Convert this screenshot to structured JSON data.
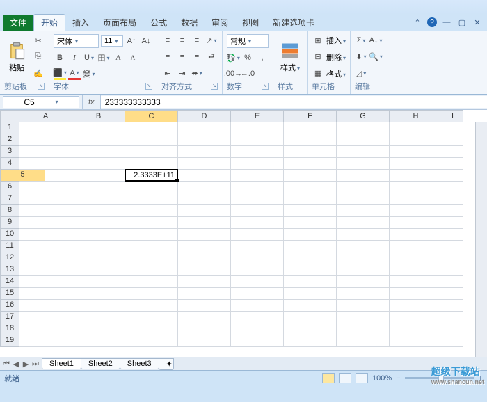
{
  "tabs": {
    "file": "文件",
    "home": "开始",
    "insert": "插入",
    "layout": "页面布局",
    "formulas": "公式",
    "data": "数据",
    "review": "审阅",
    "view": "视图",
    "newtab": "新建选项卡"
  },
  "ribbon": {
    "clipboard": {
      "label": "剪贴板",
      "paste": "粘贴"
    },
    "font": {
      "label": "字体",
      "name": "宋体",
      "size": "11"
    },
    "alignment": {
      "label": "对齐方式"
    },
    "number": {
      "label": "数字",
      "format": "常规"
    },
    "styles": {
      "label": "样式",
      "btn": "样式"
    },
    "cells": {
      "label": "单元格",
      "insert": "插入",
      "delete": "删除",
      "format": "格式"
    },
    "editing": {
      "label": "编辑"
    }
  },
  "formula": {
    "cell": "C5",
    "value": "233333333333"
  },
  "columns": [
    "A",
    "B",
    "C",
    "D",
    "E",
    "F",
    "G",
    "H",
    "I"
  ],
  "cell_display": "2.3333E+11",
  "sheets": {
    "s1": "Sheet1",
    "s2": "Sheet2",
    "s3": "Sheet3"
  },
  "status": {
    "ready": "就绪",
    "zoom": "100%"
  },
  "watermark": {
    "main": "超级下载站",
    "sub": "www.shancun.net"
  }
}
